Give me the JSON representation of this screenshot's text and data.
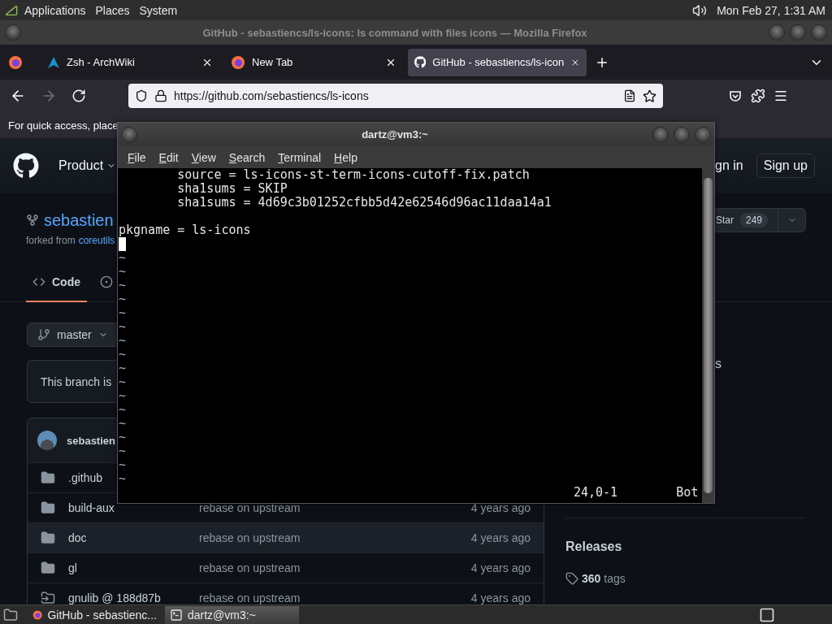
{
  "top_panel": {
    "menus": [
      "Applications",
      "Places",
      "System"
    ],
    "clock": "Mon Feb 27, 1:31 AM"
  },
  "browser": {
    "title": "GitHub - sebastiencs/ls-icons: ls command with files icons — Mozilla Firefox",
    "tabs": [
      {
        "label": "Zsh - ArchWiki",
        "selected": false
      },
      {
        "label": "New Tab",
        "selected": false
      },
      {
        "label": "GitHub - sebastiencs/ls-icon",
        "selected": true
      }
    ],
    "nav_buttons": [
      {
        "kind": "back",
        "disabled": false
      },
      {
        "kind": "forward",
        "disabled": true
      },
      {
        "kind": "reload",
        "disabled": false
      }
    ],
    "url": "https://github.com/sebastiencs/ls-icons",
    "bookmarks_hint": "For quick access, place"
  },
  "github": {
    "header": {
      "nav": "Product",
      "sign_in": "ign in",
      "sign_up": "Sign up"
    },
    "repo": {
      "name": "sebastien",
      "forked_from_label": "forked from",
      "forked_from": "coreutils",
      "star_label": "Star",
      "star_count": "249"
    },
    "tabs": [
      {
        "label": "Code",
        "selected": true
      },
      {
        "selected": false
      }
    ],
    "branch": "master",
    "branch_notice": "This branch is",
    "commit_author": "sebastien",
    "files": [
      {
        "kind": "folder",
        "name": ".github",
        "hovered": false
      },
      {
        "kind": "folder",
        "name": "build-aux",
        "message": "rebase on upstream",
        "age": "4 years ago",
        "hovered": false
      },
      {
        "kind": "folder",
        "name": "doc",
        "message": "rebase on upstream",
        "age": "4 years ago",
        "hovered": true
      },
      {
        "kind": "folder",
        "name": "gl",
        "message": "rebase on upstream",
        "age": "4 years ago",
        "hovered": false
      },
      {
        "kind": "submodule",
        "name": "gnulib @ 188d87b",
        "message": "rebase on upstream",
        "age": "4 years ago",
        "hovered": false
      }
    ],
    "sidebar": {
      "fragment": "s",
      "releases": "Releases",
      "tag_count": "360",
      "tag_label": "tags"
    }
  },
  "terminal": {
    "title": "dartz@vm3:~",
    "menus": [
      "File",
      "Edit",
      "View",
      "Search",
      "Terminal",
      "Help"
    ],
    "lines": [
      {
        "kind": "text",
        "text": "        source = ls-icons-st-term-icons-cutoff-fix.patch"
      },
      {
        "kind": "text",
        "text": "        sha1sums = SKIP"
      },
      {
        "kind": "text",
        "text": "        sha1sums = 4d69c3b01252cfbb5d42e62546d96ac11daa14a1"
      },
      {
        "kind": "blank"
      },
      {
        "kind": "text",
        "text": "pkgname = ls-icons"
      },
      {
        "kind": "cursor"
      },
      {
        "kind": "tilde",
        "text": "~"
      },
      {
        "kind": "tilde",
        "text": "~"
      },
      {
        "kind": "tilde",
        "text": "~"
      },
      {
        "kind": "tilde",
        "text": "~"
      },
      {
        "kind": "tilde",
        "text": "~"
      },
      {
        "kind": "tilde",
        "text": "~"
      },
      {
        "kind": "tilde",
        "text": "~"
      },
      {
        "kind": "tilde",
        "text": "~"
      },
      {
        "kind": "tilde",
        "text": "~"
      },
      {
        "kind": "tilde",
        "text": "~"
      },
      {
        "kind": "tilde",
        "text": "~"
      },
      {
        "kind": "tilde",
        "text": "~"
      },
      {
        "kind": "tilde",
        "text": "~"
      },
      {
        "kind": "tilde",
        "text": "~"
      },
      {
        "kind": "tilde",
        "text": "~"
      },
      {
        "kind": "tilde",
        "text": "~"
      },
      {
        "kind": "tilde",
        "text": "~"
      }
    ],
    "position": "24,0-1",
    "scroll": "Bot"
  },
  "taskbar": {
    "items": [
      {
        "label": "GitHub - sebastienc...",
        "selected": false
      },
      {
        "label": "dartz@vm3:~",
        "selected": true
      }
    ]
  }
}
